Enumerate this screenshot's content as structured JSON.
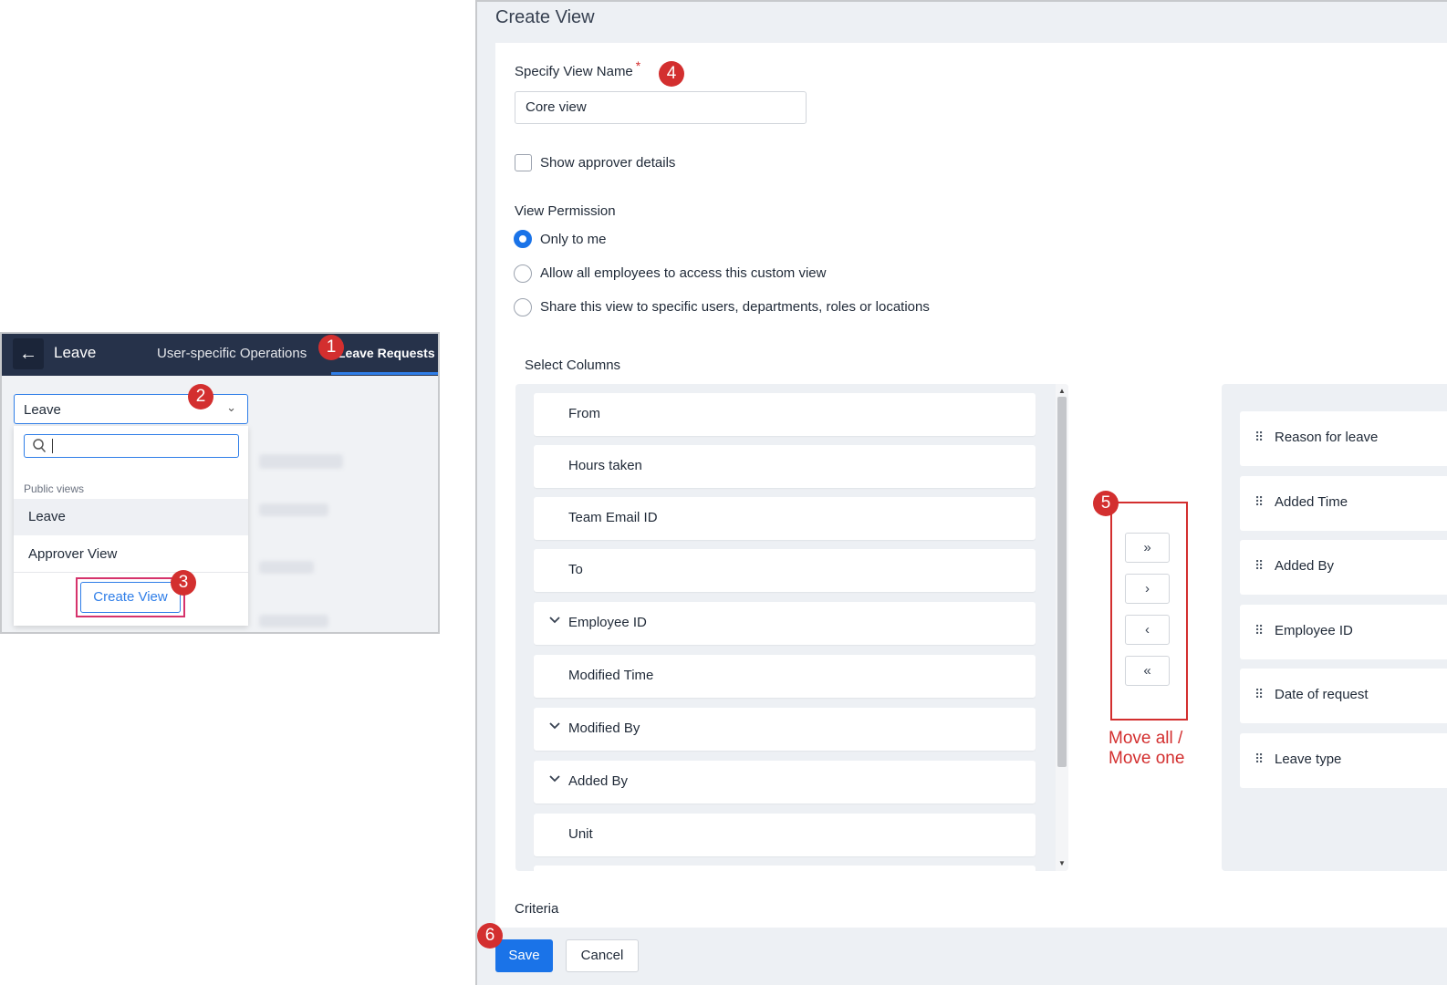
{
  "left_panel": {
    "header": {
      "back_icon": "arrow-left-icon",
      "title": "Leave",
      "tabs": [
        "User-specific Operations",
        "Leave Requests"
      ]
    },
    "view_select": {
      "value": "Leave"
    },
    "dropdown": {
      "search_value": "",
      "group_label": "Public views",
      "items": [
        "Leave",
        "Approver View"
      ],
      "create_button": "Create View"
    }
  },
  "create_view": {
    "title": "Create View",
    "view_name": {
      "label": "Specify View Name",
      "required_mark": "*",
      "value": "Core view"
    },
    "show_approver": {
      "label": "Show approver details",
      "checked": false
    },
    "permission": {
      "label": "View Permission",
      "options": [
        "Only to me",
        "Allow all employees to access this custom view",
        "Share this view to specific users, departments, roles or locations"
      ],
      "selected": 0
    },
    "select_columns": {
      "label": "Select Columns",
      "available": [
        "From",
        "Hours taken",
        "Team Email ID",
        "To",
        "Employee ID",
        "Modified Time",
        "Modified By",
        "Added By",
        "Unit"
      ],
      "expandable": [
        "Employee ID",
        "Modified By",
        "Added By"
      ],
      "selected": [
        "Reason for leave",
        "Added Time",
        "Added By",
        "Employee ID",
        "Date of request",
        "Leave type"
      ],
      "move_buttons": [
        "»",
        "›",
        "‹",
        "«"
      ],
      "move_caption": [
        "Move all /",
        "Move one"
      ]
    },
    "criteria_label": "Criteria",
    "save_label": "Save",
    "cancel_label": "Cancel"
  },
  "annotations": [
    "1",
    "2",
    "3",
    "4",
    "5",
    "6"
  ],
  "colors": {
    "header_bg": "#26324a",
    "accent": "#1a73e8",
    "annotation": "#d32f2f"
  }
}
